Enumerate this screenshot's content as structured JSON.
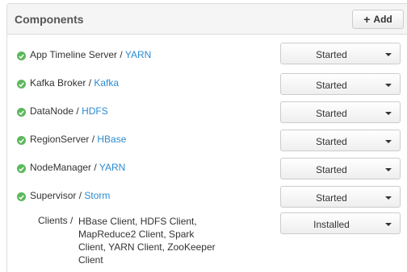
{
  "panel": {
    "title": "Components",
    "add_button_label": "Add",
    "add_icon": "plus-icon"
  },
  "components": [
    {
      "name": "App Timeline Server",
      "service": "YARN",
      "state": "Started",
      "status_icon": "check-circle-icon"
    },
    {
      "name": "Kafka Broker",
      "service": "Kafka",
      "state": "Started",
      "status_icon": "check-circle-icon"
    },
    {
      "name": "DataNode",
      "service": "HDFS",
      "state": "Started",
      "status_icon": "check-circle-icon"
    },
    {
      "name": "RegionServer",
      "service": "HBase",
      "state": "Started",
      "status_icon": "check-circle-icon"
    },
    {
      "name": "NodeManager",
      "service": "YARN",
      "state": "Started",
      "status_icon": "check-circle-icon"
    },
    {
      "name": "Supervisor",
      "service": "Storm",
      "state": "Started",
      "status_icon": "check-circle-icon"
    }
  ],
  "clients": {
    "label": "Clients /",
    "list": "HBase Client, HDFS Client, MapReduce2 Client, Spark Client, YARN Client, ZooKeeper Client",
    "state": "Installed"
  },
  "colors": {
    "ok_green": "#5cb85c",
    "link_blue": "#2a8bd0",
    "header_bg": "#f5f5f5"
  }
}
